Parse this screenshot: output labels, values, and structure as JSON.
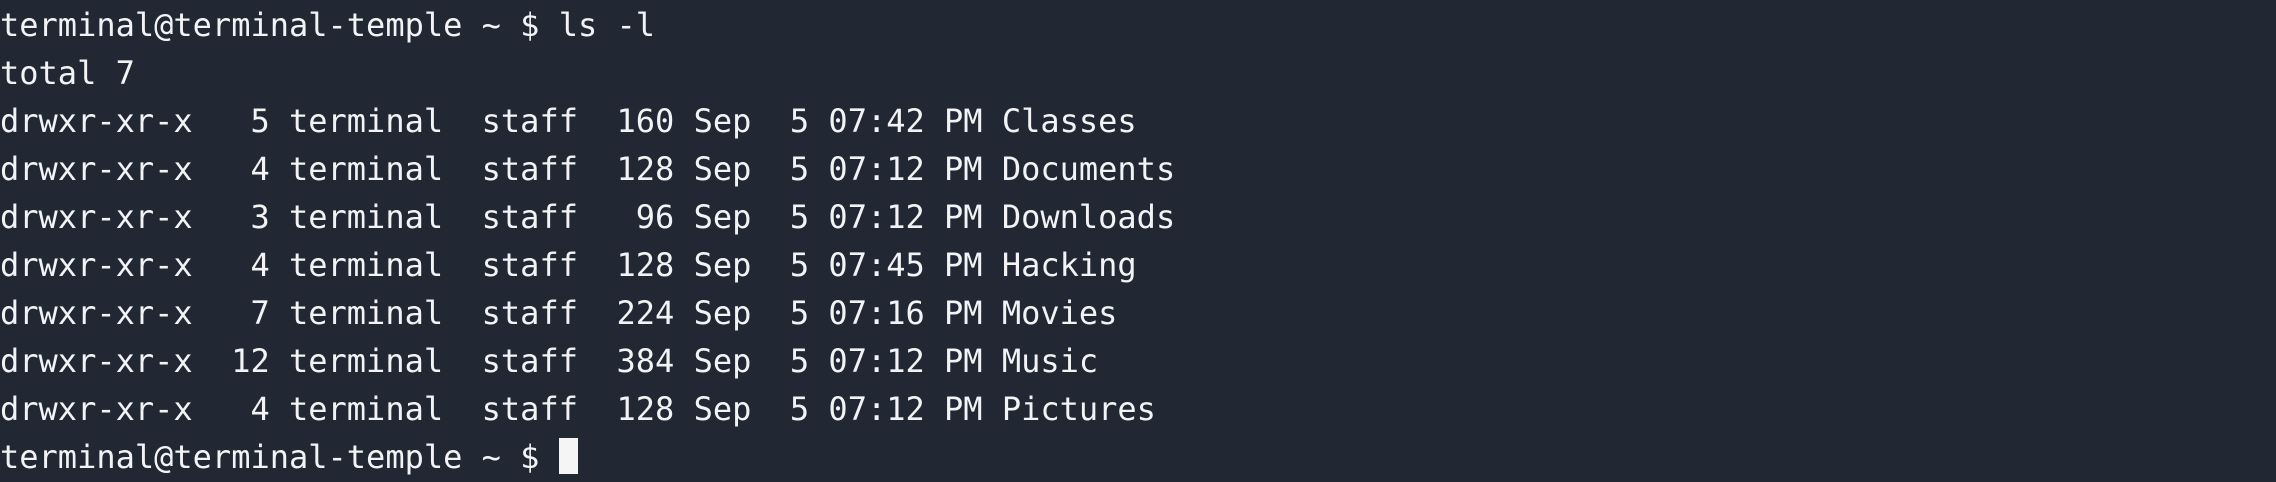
{
  "terminal": {
    "command_prompt": "terminal@terminal-temple ~ $ ls -l",
    "total_line": "total 7",
    "entries": [
      "drwxr-xr-x   5 terminal  staff  160 Sep  5 07:42 PM Classes",
      "drwxr-xr-x   4 terminal  staff  128 Sep  5 07:12 PM Documents",
      "drwxr-xr-x   3 terminal  staff   96 Sep  5 07:12 PM Downloads",
      "drwxr-xr-x   4 terminal  staff  128 Sep  5 07:45 PM Hacking",
      "drwxr-xr-x   7 terminal  staff  224 Sep  5 07:16 PM Movies",
      "drwxr-xr-x  12 terminal  staff  384 Sep  5 07:12 PM Music",
      "drwxr-xr-x   4 terminal  staff  128 Sep  5 07:12 PM Pictures"
    ],
    "current_prompt": "terminal@terminal-temple ~ $ "
  },
  "colors": {
    "background": "#212834",
    "foreground": "#f2f3f5",
    "cursor": "#f5f5f5"
  }
}
